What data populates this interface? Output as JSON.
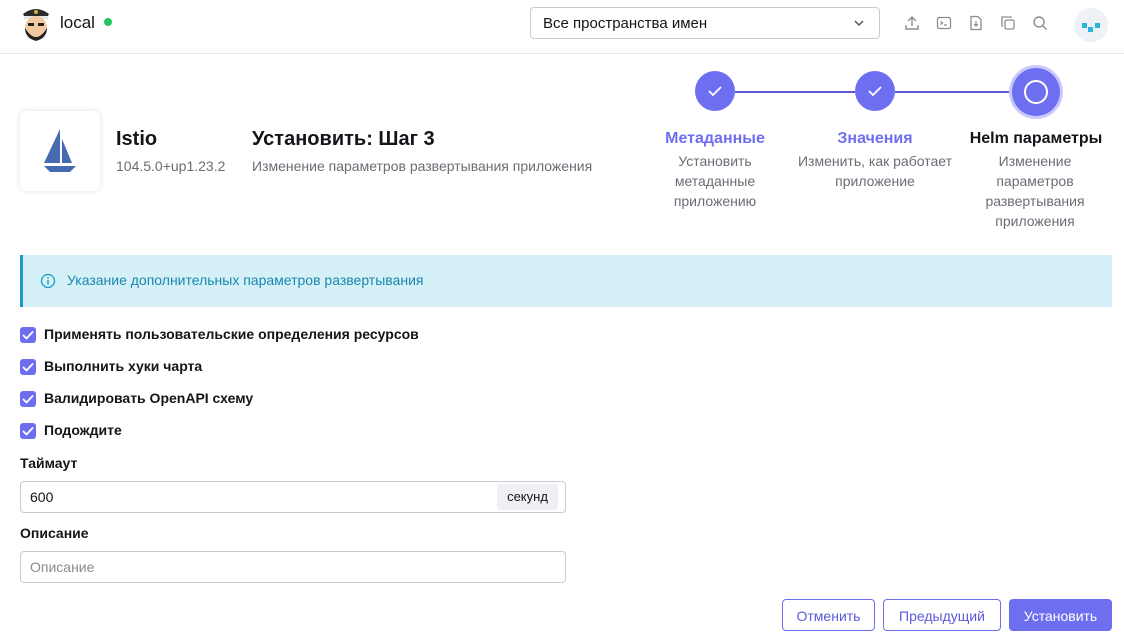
{
  "header": {
    "cluster_name": "local",
    "namespace_select": {
      "selected": "Все пространства имен"
    },
    "icons": [
      "upload-icon",
      "terminal-icon",
      "file-download-icon",
      "copy-icon",
      "search-icon"
    ]
  },
  "app": {
    "name": "Istio",
    "version": "104.5.0+up1.23.2"
  },
  "wizard": {
    "title": "Установить: Шаг 3",
    "subtitle": "Изменение параметров развертывания приложения",
    "steps": [
      {
        "label": "Метаданные",
        "description": "Установить метаданные приложению",
        "state": "done"
      },
      {
        "label": "Значения",
        "description": "Изменить, как работает приложение",
        "state": "done"
      },
      {
        "label": "Helm параметры",
        "description": "Изменение параметров развертывания приложения",
        "state": "current"
      }
    ]
  },
  "info_banner": {
    "text": "Указание дополнительных параметров развертывания"
  },
  "options": [
    {
      "label": "Применять пользовательские определения ресурсов",
      "checked": true
    },
    {
      "label": "Выполнить хуки чарта",
      "checked": true
    },
    {
      "label": "Валидировать OpenAPI схему",
      "checked": true
    },
    {
      "label": "Подождите",
      "checked": true
    }
  ],
  "timeout": {
    "label": "Таймаут",
    "value": "600",
    "unit": "секунд"
  },
  "description": {
    "label": "Описание",
    "value": "",
    "placeholder": "Описание"
  },
  "buttons": {
    "cancel": "Отменить",
    "previous": "Предыдущий",
    "install": "Установить"
  },
  "colors": {
    "accent": "#6e6ef0",
    "status_ok": "#22c55e",
    "info_bg": "#d6f0f7",
    "info_text": "#1987b0"
  }
}
